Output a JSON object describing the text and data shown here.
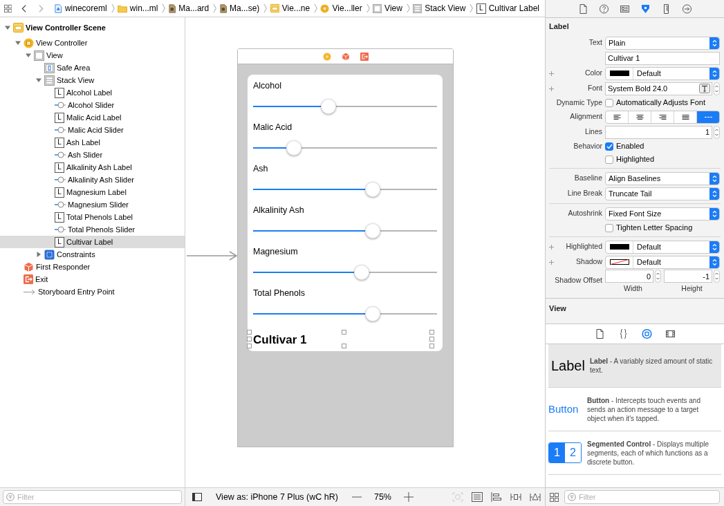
{
  "breadcrumbs": [
    {
      "kind": "project",
      "label": "winecoreml"
    },
    {
      "kind": "folder",
      "label": "win...ml"
    },
    {
      "kind": "storyboard",
      "label": "Ma...ard"
    },
    {
      "kind": "storyboard",
      "label": "Ma...se)"
    },
    {
      "kind": "scene",
      "label": "Vie...ne"
    },
    {
      "kind": "controller",
      "label": "Vie...ller"
    },
    {
      "kind": "view",
      "label": "View"
    },
    {
      "kind": "stack",
      "label": "Stack View"
    },
    {
      "kind": "label",
      "glyph": "L",
      "label": "Cultivar Label"
    }
  ],
  "outline": [
    {
      "kind": "scene",
      "label": "View Controller Scene",
      "expanded": true,
      "selected": false,
      "children": [
        {
          "kind": "controller",
          "label": "View Controller",
          "expanded": true,
          "selected": false,
          "children": [
            {
              "kind": "view",
              "label": "View",
              "expanded": true,
              "selected": false,
              "children": [
                {
                  "kind": "safearea",
                  "label": "Safe Area",
                  "selected": false
                },
                {
                  "kind": "stack",
                  "label": "Stack View",
                  "expanded": true,
                  "selected": false,
                  "children": [
                    {
                      "kind": "label",
                      "glyph": "L",
                      "label": "Alcohol Label",
                      "selected": false
                    },
                    {
                      "kind": "slider",
                      "label": "Alcohol Slider",
                      "selected": false
                    },
                    {
                      "kind": "label",
                      "glyph": "L",
                      "label": "Malic Acid Label",
                      "selected": false
                    },
                    {
                      "kind": "slider",
                      "label": "Malic Acid Slider",
                      "selected": false
                    },
                    {
                      "kind": "label",
                      "glyph": "L",
                      "label": "Ash Label",
                      "selected": false
                    },
                    {
                      "kind": "slider",
                      "label": "Ash Slider",
                      "selected": false
                    },
                    {
                      "kind": "label",
                      "glyph": "L",
                      "label": "Alkalinity Ash Label",
                      "selected": false
                    },
                    {
                      "kind": "slider",
                      "label": "Alkalinity Ash Slider",
                      "selected": false
                    },
                    {
                      "kind": "label",
                      "glyph": "L",
                      "label": "Magnesium Label",
                      "selected": false
                    },
                    {
                      "kind": "slider",
                      "label": "Magnesium Slider",
                      "selected": false
                    },
                    {
                      "kind": "label",
                      "glyph": "L",
                      "label": "Total Phenols Label",
                      "selected": false
                    },
                    {
                      "kind": "slider",
                      "label": "Total Phenols Slider",
                      "selected": false
                    },
                    {
                      "kind": "label",
                      "glyph": "L",
                      "label": "Cultivar Label",
                      "selected": true
                    }
                  ]
                },
                {
                  "kind": "constraints",
                  "label": "Constraints",
                  "expanded": false,
                  "selected": false
                }
              ]
            }
          ]
        },
        {
          "kind": "responder",
          "label": "First Responder",
          "selected": false
        },
        {
          "kind": "exit",
          "label": "Exit",
          "selected": false
        },
        {
          "kind": "entry",
          "label": "Storyboard Entry Point",
          "selected": false
        }
      ]
    }
  ],
  "outline_filter": {
    "placeholder": "Filter"
  },
  "canvas": {
    "sliders": [
      {
        "label": "Alcohol",
        "level": 0.41
      },
      {
        "label": "Malic Acid",
        "level": 0.22
      },
      {
        "label": "Ash",
        "level": 0.65
      },
      {
        "label": "Alkalinity Ash",
        "level": 0.65
      },
      {
        "label": "Magnesium",
        "level": 0.59
      },
      {
        "label": "Total Phenols",
        "level": 0.65
      }
    ],
    "result_label": "Cultivar 1"
  },
  "canvas_bar": {
    "view_as": "View as: iPhone 7 Plus (wC hR)",
    "zoom": "75%"
  },
  "inspector_tabs": [
    {
      "kind": "file",
      "selected": false
    },
    {
      "kind": "help",
      "selected": false
    },
    {
      "kind": "identity",
      "selected": false
    },
    {
      "kind": "attributes",
      "selected": true
    },
    {
      "kind": "size",
      "selected": false
    },
    {
      "kind": "connections",
      "selected": false
    }
  ],
  "label_section": {
    "title": "Label",
    "groups": [
      [
        {
          "kind": "popup",
          "label": "Text",
          "value": "Plain"
        },
        {
          "kind": "text",
          "value": "Cultivar 1"
        },
        {
          "kind": "color",
          "plus": true,
          "label": "Color",
          "clear_swatch": false,
          "value": "Default"
        },
        {
          "kind": "font",
          "plus": true,
          "label": "Font",
          "value": "System Bold 24.0"
        },
        {
          "kind": "checkbox",
          "label": "Dynamic Type",
          "text": "Automatically Adjusts Font",
          "checked": false
        },
        {
          "kind": "segmented",
          "label": "Alignment",
          "segments": [
            {
              "kind": "left",
              "selected": false
            },
            {
              "kind": "center",
              "selected": false
            },
            {
              "kind": "right",
              "selected": false
            },
            {
              "kind": "justified",
              "selected": false
            },
            {
              "kind": "natural",
              "selected": true
            }
          ]
        },
        {
          "kind": "number",
          "label": "Lines",
          "value": "1"
        },
        {
          "kind": "checkbox",
          "label": "Behavior",
          "text": "Enabled",
          "checked": true
        },
        {
          "kind": "checkbox",
          "text": "Highlighted",
          "checked": false
        }
      ],
      [
        {
          "kind": "popup",
          "label": "Baseline",
          "value": "Align Baselines"
        },
        {
          "kind": "popup",
          "label": "Line Break",
          "value": "Truncate Tail"
        }
      ],
      [
        {
          "kind": "popup",
          "label": "Autoshrink",
          "value": "Fixed Font Size"
        },
        {
          "kind": "checkbox",
          "text": "Tighten Letter Spacing",
          "checked": false
        }
      ],
      [
        {
          "kind": "color",
          "plus": true,
          "label": "Highlighted",
          "clear_swatch": false,
          "value": "Default"
        },
        {
          "kind": "color",
          "plus": true,
          "label": "Shadow",
          "clear_swatch": true,
          "value": "Default"
        },
        {
          "kind": "pair",
          "label": "Shadow Offset",
          "fields": [
            {
              "value": "0",
              "caption": "Width"
            },
            {
              "value": "-1",
              "caption": "Height"
            }
          ]
        }
      ]
    ]
  },
  "view_section": {
    "title": "View"
  },
  "library_tabs": [
    {
      "kind": "file",
      "selected": false
    },
    {
      "kind": "braces",
      "selected": false
    },
    {
      "kind": "object",
      "selected": true
    },
    {
      "kind": "media",
      "selected": false
    }
  ],
  "library": [
    {
      "kind": "label",
      "preview": "Label",
      "text": "**Label** - A variably sized amount of static text.",
      "selected": true
    },
    {
      "kind": "button",
      "preview": "Button",
      "text": "**Button** - Intercepts touch events and sends an action message to a target object when it's tapped.",
      "selected": false
    },
    {
      "kind": "segmented",
      "segments": [
        {
          "label": "1",
          "selected": true
        },
        {
          "label": "2",
          "selected": false
        }
      ],
      "text": "**Segmented Control** - Displays multiple segments, each of which functions as a discrete button.",
      "selected": false
    }
  ],
  "library_filter": {
    "placeholder": "Filter"
  }
}
